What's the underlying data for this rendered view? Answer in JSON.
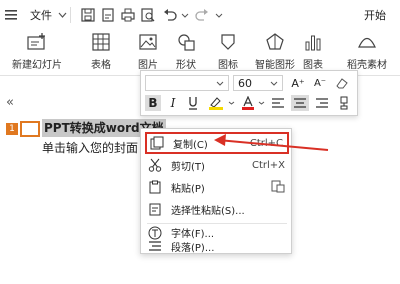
{
  "quick_access": {
    "menu_label": "文件",
    "start_tab": "开始"
  },
  "ribbon": {
    "new_slide": "新建幻灯片",
    "table": "表格",
    "picture": "图片",
    "shape": "形状",
    "icon": "图标",
    "smart_graphic": "智能图形",
    "chart": "图表",
    "material": "稻壳素材"
  },
  "format_bar": {
    "font_size": "60",
    "bold": "B",
    "italic": "I",
    "colors": {
      "highlight": "#f5d900",
      "font": "#e02020"
    }
  },
  "slide": {
    "slide_number": "1",
    "title_text": "PPT转换成word文档",
    "subtitle_text": "单击输入您的封面"
  },
  "context_menu": {
    "items": [
      {
        "label": "复制(C)",
        "shortcut": "Ctrl+C"
      },
      {
        "label": "剪切(T)",
        "shortcut": "Ctrl+X"
      },
      {
        "label": "粘贴(P)",
        "shortcut": ""
      },
      {
        "label": "选择性粘贴(S)...",
        "shortcut": ""
      },
      {
        "label": "字体(F)...",
        "shortcut": ""
      },
      {
        "label": "段落(P)...",
        "shortcut": ""
      }
    ],
    "highlight_color": "#d93025"
  }
}
